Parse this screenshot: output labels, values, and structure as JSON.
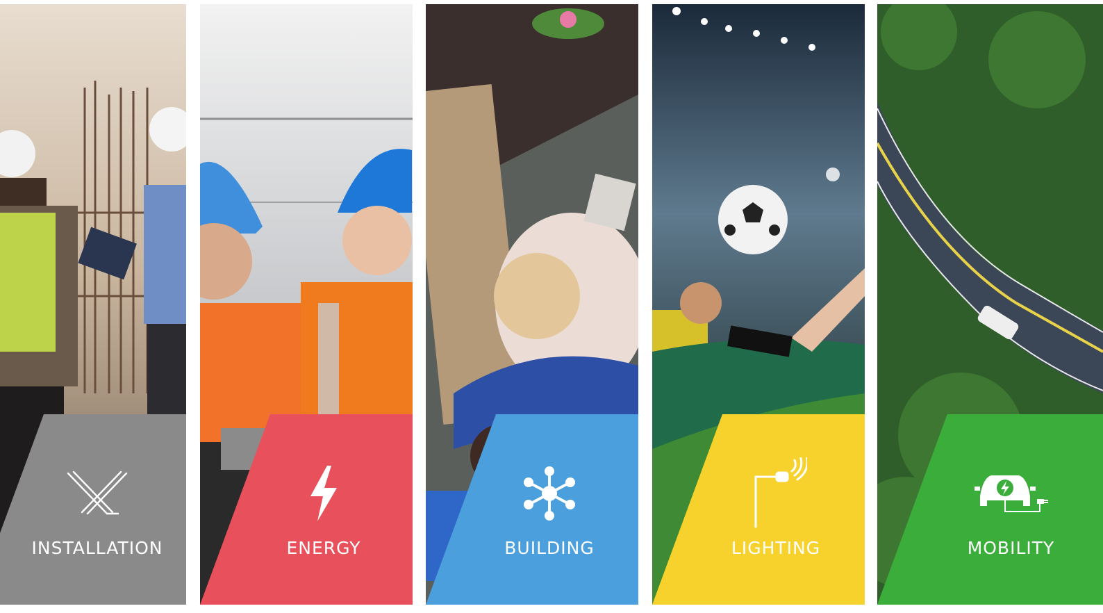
{
  "panels": [
    {
      "id": "installation",
      "label": "INSTALLATION",
      "color": "#8a8a8a",
      "icon": "crossed-cables-icon"
    },
    {
      "id": "energy",
      "label": "ENERGY",
      "color": "#e8505b",
      "icon": "lightning-bolt-icon"
    },
    {
      "id": "building",
      "label": "BUILDING",
      "color": "#4a9fdc",
      "icon": "network-node-icon"
    },
    {
      "id": "lighting",
      "label": "LIGHTING",
      "color": "#f8d22c",
      "icon": "street-lamp-icon"
    },
    {
      "id": "mobility",
      "label": "MOBILITY",
      "color": "#3aad3a",
      "icon": "electric-car-charging-icon"
    }
  ]
}
